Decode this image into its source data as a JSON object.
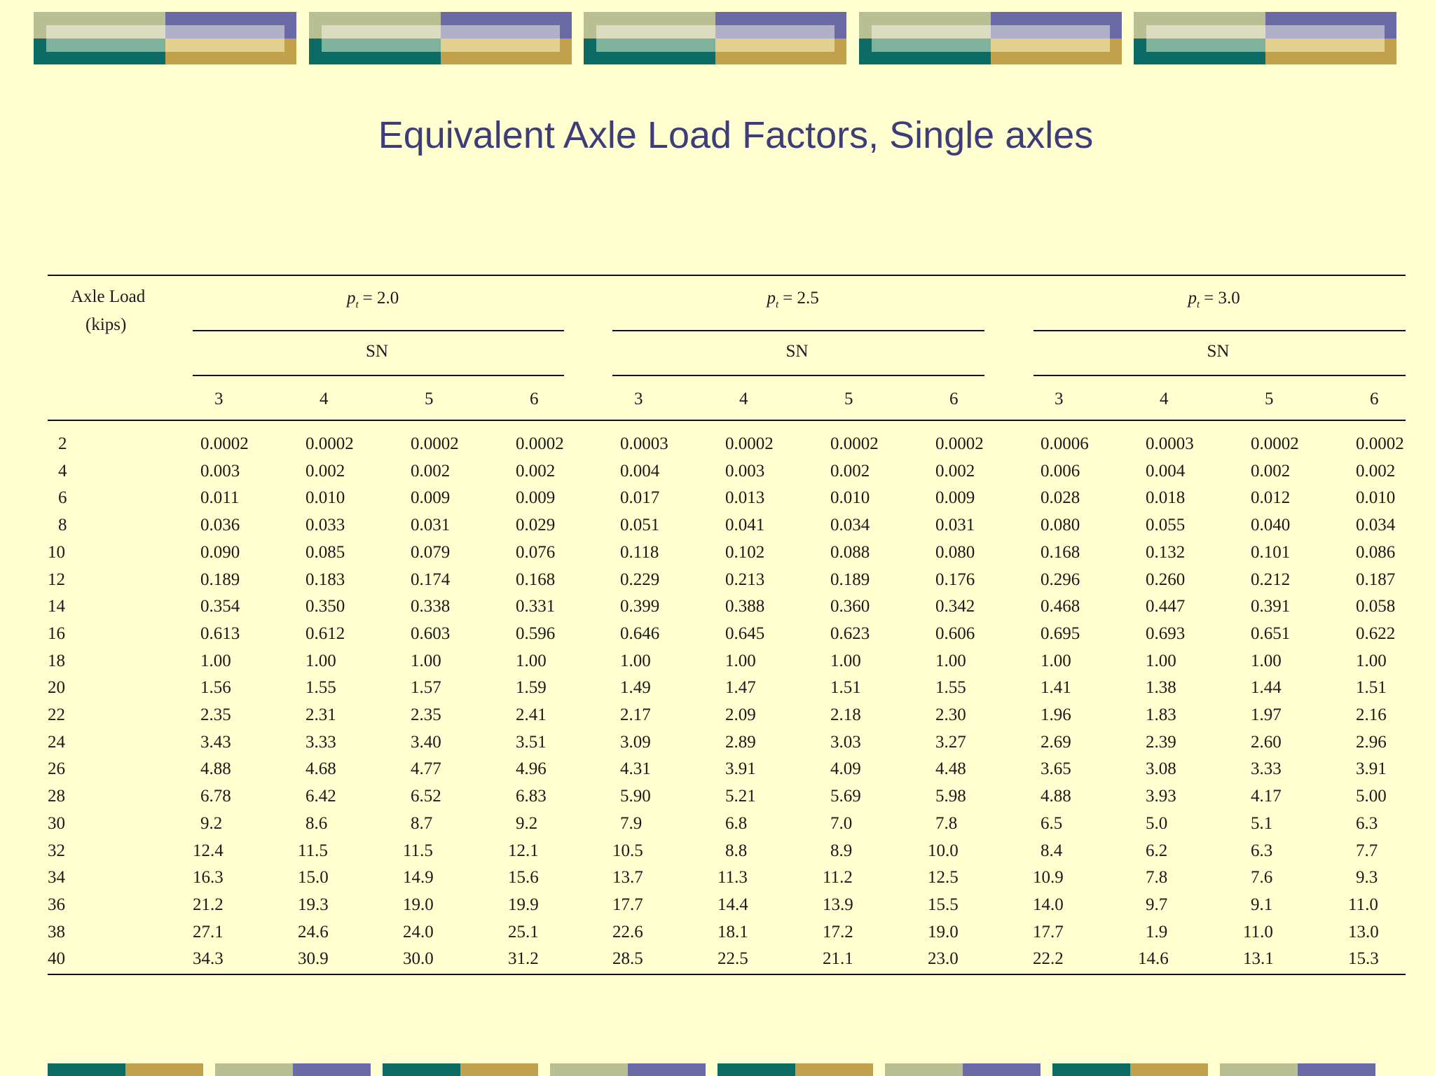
{
  "slide": {
    "title": "Equivalent Axle Load Factors, Single axles"
  },
  "table": {
    "row_header": [
      "Axle Load",
      "(kips)"
    ],
    "groups": [
      {
        "pt_label": "p",
        "pt_sub": "t",
        "pt_value": "= 2.0",
        "sn_label": "SN",
        "sn_values": [
          "3",
          "4",
          "5",
          "6"
        ]
      },
      {
        "pt_label": "p",
        "pt_sub": "t",
        "pt_value": "= 2.5",
        "sn_label": "SN",
        "sn_values": [
          "3",
          "4",
          "5",
          "6"
        ]
      },
      {
        "pt_label": "p",
        "pt_sub": "t",
        "pt_value": "= 3.0",
        "sn_label": "SN",
        "sn_values": [
          "3",
          "4",
          "5",
          "6"
        ]
      }
    ],
    "rows": [
      {
        "load": "2",
        "v": [
          "0.0002",
          "0.0002",
          "0.0002",
          "0.0002",
          "0.0003",
          "0.0002",
          "0.0002",
          "0.0002",
          "0.0006",
          "0.0003",
          "0.0002",
          "0.0002"
        ]
      },
      {
        "load": "4",
        "v": [
          "0.003",
          "0.002",
          "0.002",
          "0.002",
          "0.004",
          "0.003",
          "0.002",
          "0.002",
          "0.006",
          "0.004",
          "0.002",
          "0.002"
        ]
      },
      {
        "load": "6",
        "v": [
          "0.011",
          "0.010",
          "0.009",
          "0.009",
          "0.017",
          "0.013",
          "0.010",
          "0.009",
          "0.028",
          "0.018",
          "0.012",
          "0.010"
        ]
      },
      {
        "load": "8",
        "v": [
          "0.036",
          "0.033",
          "0.031",
          "0.029",
          "0.051",
          "0.041",
          "0.034",
          "0.031",
          "0.080",
          "0.055",
          "0.040",
          "0.034"
        ]
      },
      {
        "load": "10",
        "v": [
          "0.090",
          "0.085",
          "0.079",
          "0.076",
          "0.118",
          "0.102",
          "0.088",
          "0.080",
          "0.168",
          "0.132",
          "0.101",
          "0.086"
        ]
      },
      {
        "load": "12",
        "v": [
          "0.189",
          "0.183",
          "0.174",
          "0.168",
          "0.229",
          "0.213",
          "0.189",
          "0.176",
          "0.296",
          "0.260",
          "0.212",
          "0.187"
        ]
      },
      {
        "load": "14",
        "v": [
          "0.354",
          "0.350",
          "0.338",
          "0.331",
          "0.399",
          "0.388",
          "0.360",
          "0.342",
          "0.468",
          "0.447",
          "0.391",
          "0.058"
        ]
      },
      {
        "load": "16",
        "v": [
          "0.613",
          "0.612",
          "0.603",
          "0.596",
          "0.646",
          "0.645",
          "0.623",
          "0.606",
          "0.695",
          "0.693",
          "0.651",
          "0.622"
        ]
      },
      {
        "load": "18",
        "v": [
          "1.00",
          "1.00",
          "1.00",
          "1.00",
          "1.00",
          "1.00",
          "1.00",
          "1.00",
          "1.00",
          "1.00",
          "1.00",
          "1.00"
        ]
      },
      {
        "load": "20",
        "v": [
          "1.56",
          "1.55",
          "1.57",
          "1.59",
          "1.49",
          "1.47",
          "1.51",
          "1.55",
          "1.41",
          "1.38",
          "1.44",
          "1.51"
        ]
      },
      {
        "load": "22",
        "v": [
          "2.35",
          "2.31",
          "2.35",
          "2.41",
          "2.17",
          "2.09",
          "2.18",
          "2.30",
          "1.96",
          "1.83",
          "1.97",
          "2.16"
        ]
      },
      {
        "load": "24",
        "v": [
          "3.43",
          "3.33",
          "3.40",
          "3.51",
          "3.09",
          "2.89",
          "3.03",
          "3.27",
          "2.69",
          "2.39",
          "2.60",
          "2.96"
        ]
      },
      {
        "load": "26",
        "v": [
          "4.88",
          "4.68",
          "4.77",
          "4.96",
          "4.31",
          "3.91",
          "4.09",
          "4.48",
          "3.65",
          "3.08",
          "3.33",
          "3.91"
        ]
      },
      {
        "load": "28",
        "v": [
          "6.78",
          "6.42",
          "6.52",
          "6.83",
          "5.90",
          "5.21",
          "5.69",
          "5.98",
          "4.88",
          "3.93",
          "4.17",
          "5.00"
        ]
      },
      {
        "load": "30",
        "v": [
          "9.2",
          "8.6",
          "8.7",
          "9.2",
          "7.9",
          "6.8",
          "7.0",
          "7.8",
          "6.5",
          "5.0",
          "5.1",
          "6.3"
        ]
      },
      {
        "load": "32",
        "v": [
          "12.4",
          "11.5",
          "11.5",
          "12.1",
          "10.5",
          "8.8",
          "8.9",
          "10.0",
          "8.4",
          "6.2",
          "6.3",
          "7.7"
        ]
      },
      {
        "load": "34",
        "v": [
          "16.3",
          "15.0",
          "14.9",
          "15.6",
          "13.7",
          "11.3",
          "11.2",
          "12.5",
          "10.9",
          "7.8",
          "7.6",
          "9.3"
        ]
      },
      {
        "load": "36",
        "v": [
          "21.2",
          "19.3",
          "19.0",
          "19.9",
          "17.7",
          "14.4",
          "13.9",
          "15.5",
          "14.0",
          "9.7",
          "9.1",
          "11.0"
        ]
      },
      {
        "load": "38",
        "v": [
          "27.1",
          "24.6",
          "24.0",
          "25.1",
          "22.6",
          "18.1",
          "17.2",
          "19.0",
          "17.7",
          "1.9",
          "11.0",
          "13.0"
        ]
      },
      {
        "load": "40",
        "v": [
          "34.3",
          "30.9",
          "30.0",
          "31.2",
          "28.5",
          "22.5",
          "21.1",
          "23.0",
          "22.2",
          "14.6",
          "13.1",
          "15.3"
        ]
      }
    ]
  }
}
